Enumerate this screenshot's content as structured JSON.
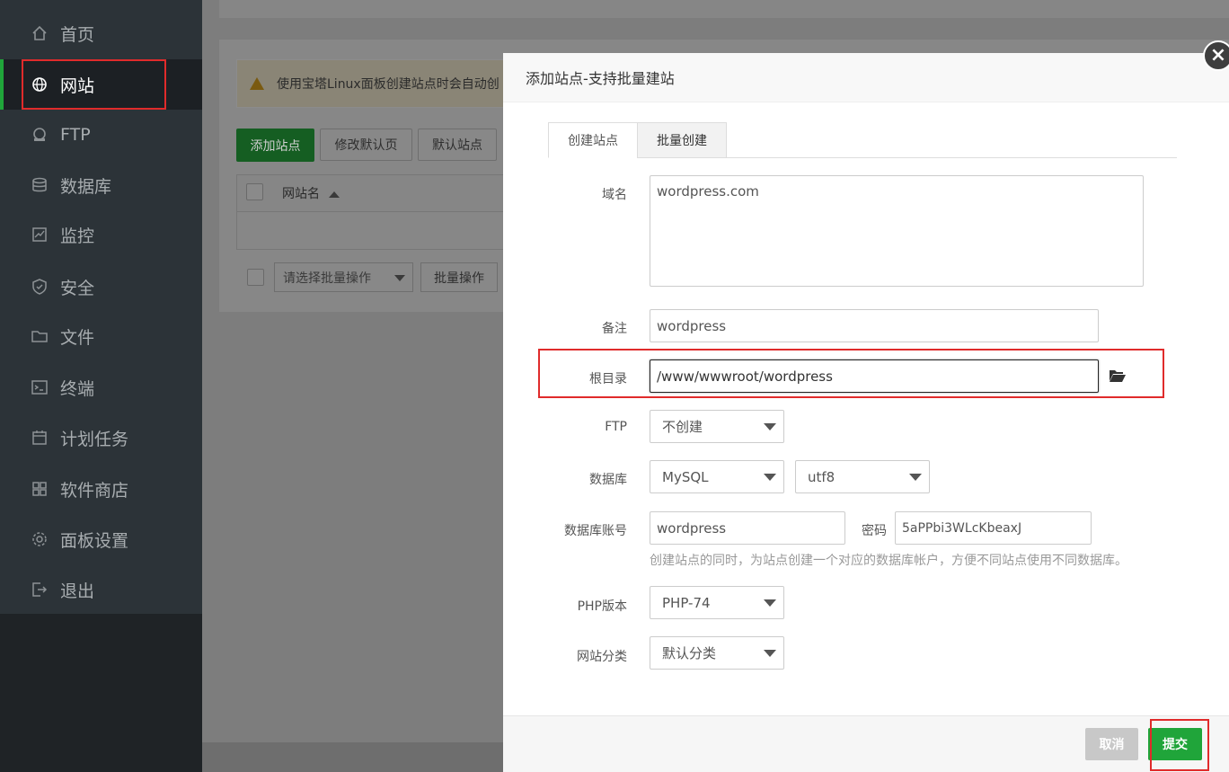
{
  "sidebar": {
    "items": [
      {
        "label": "首页",
        "icon": "home-icon"
      },
      {
        "label": "网站",
        "icon": "globe-icon"
      },
      {
        "label": "FTP",
        "icon": "ftp-icon"
      },
      {
        "label": "数据库",
        "icon": "database-icon"
      },
      {
        "label": "监控",
        "icon": "monitor-icon"
      },
      {
        "label": "安全",
        "icon": "shield-icon"
      },
      {
        "label": "文件",
        "icon": "folder-icon"
      },
      {
        "label": "终端",
        "icon": "terminal-icon"
      },
      {
        "label": "计划任务",
        "icon": "calendar-icon"
      },
      {
        "label": "软件商店",
        "icon": "apps-icon"
      },
      {
        "label": "面板设置",
        "icon": "gear-icon"
      },
      {
        "label": "退出",
        "icon": "logout-icon"
      }
    ]
  },
  "background": {
    "notice": "使用宝塔Linux面板创建站点时会自动创",
    "buttons": {
      "add_site": "添加站点",
      "modify_default_page": "修改默认页",
      "default_site": "默认站点"
    },
    "table": {
      "col_site_name": "网站名"
    },
    "batch_select_placeholder": "请选择批量操作",
    "batch_button": "批量操作"
  },
  "modal": {
    "title": "添加站点-支持批量建站",
    "close": "×",
    "tabs": [
      {
        "label": "创建站点"
      },
      {
        "label": "批量创建"
      }
    ],
    "form": {
      "domain": {
        "label": "域名",
        "value": "wordpress.com"
      },
      "remark": {
        "label": "备注",
        "value": "wordpress"
      },
      "root": {
        "label": "根目录",
        "value": "/www/wwwroot/wordpress"
      },
      "ftp": {
        "label": "FTP",
        "value": "不创建"
      },
      "database": {
        "label": "数据库",
        "type": "MySQL",
        "charset": "utf8"
      },
      "db_account": {
        "label": "数据库账号",
        "value": "wordpress",
        "password_label": "密码",
        "password": "5aPPbi3WLcKbeaxJ"
      },
      "db_hint": "创建站点的同时，为站点创建一个对应的数据库帐户，方便不同站点使用不同数据库。",
      "php_version": {
        "label": "PHP版本",
        "value": "PHP-74"
      },
      "category": {
        "label": "网站分类",
        "value": "默认分类"
      }
    },
    "footer": {
      "cancel": "取消",
      "submit": "提交"
    }
  },
  "colors": {
    "accent": "#20a53a",
    "annotation": "#e02b2b",
    "sidebar_bg": "#2c3338"
  }
}
